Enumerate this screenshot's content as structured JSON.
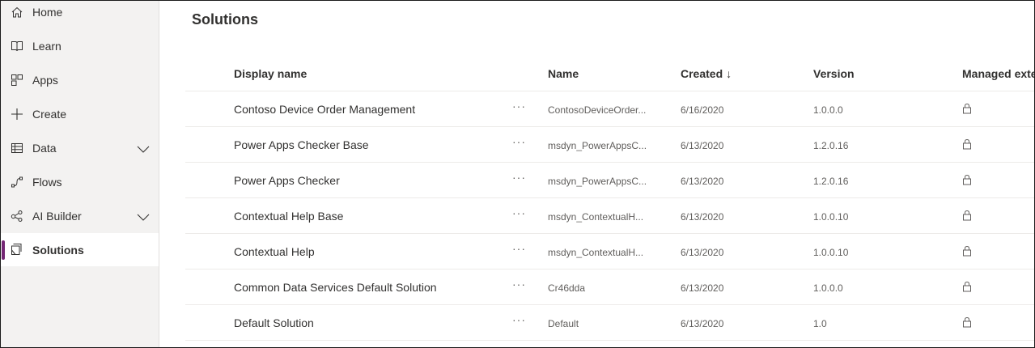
{
  "sidebar": {
    "items": [
      {
        "label": "Home",
        "icon": "home-icon"
      },
      {
        "label": "Learn",
        "icon": "book-icon"
      },
      {
        "label": "Apps",
        "icon": "apps-icon"
      },
      {
        "label": "Create",
        "icon": "plus-icon"
      },
      {
        "label": "Data",
        "icon": "table-icon",
        "expandable": true
      },
      {
        "label": "Flows",
        "icon": "flow-icon"
      },
      {
        "label": "AI Builder",
        "icon": "ai-builder-icon",
        "expandable": true
      },
      {
        "label": "Solutions",
        "icon": "solutions-icon",
        "selected": true
      }
    ],
    "accent_color": "#742774"
  },
  "main": {
    "title": "Solutions",
    "columns": {
      "display_name": "Display name",
      "name": "Name",
      "created": "Created",
      "created_sort": "↓",
      "version": "Version",
      "managed": "Managed exter"
    },
    "more_label": "···",
    "rows": [
      {
        "display_name": "Contoso Device Order Management",
        "name": "ContosoDeviceOrder...",
        "created": "6/16/2020",
        "version": "1.0.0.0",
        "managed": "lock-icon"
      },
      {
        "display_name": "Power Apps Checker Base",
        "name": "msdyn_PowerAppsC...",
        "created": "6/13/2020",
        "version": "1.2.0.16",
        "managed": "lock-icon"
      },
      {
        "display_name": "Power Apps Checker",
        "name": "msdyn_PowerAppsC...",
        "created": "6/13/2020",
        "version": "1.2.0.16",
        "managed": "lock-icon"
      },
      {
        "display_name": "Contextual Help Base",
        "name": "msdyn_ContextualH...",
        "created": "6/13/2020",
        "version": "1.0.0.10",
        "managed": "lock-icon"
      },
      {
        "display_name": "Contextual Help",
        "name": "msdyn_ContextualH...",
        "created": "6/13/2020",
        "version": "1.0.0.10",
        "managed": "lock-icon"
      },
      {
        "display_name": "Common Data Services Default Solution",
        "name": "Cr46dda",
        "created": "6/13/2020",
        "version": "1.0.0.0",
        "managed": "lock-icon"
      },
      {
        "display_name": "Default Solution",
        "name": "Default",
        "created": "6/13/2020",
        "version": "1.0",
        "managed": "lock-icon"
      }
    ]
  }
}
